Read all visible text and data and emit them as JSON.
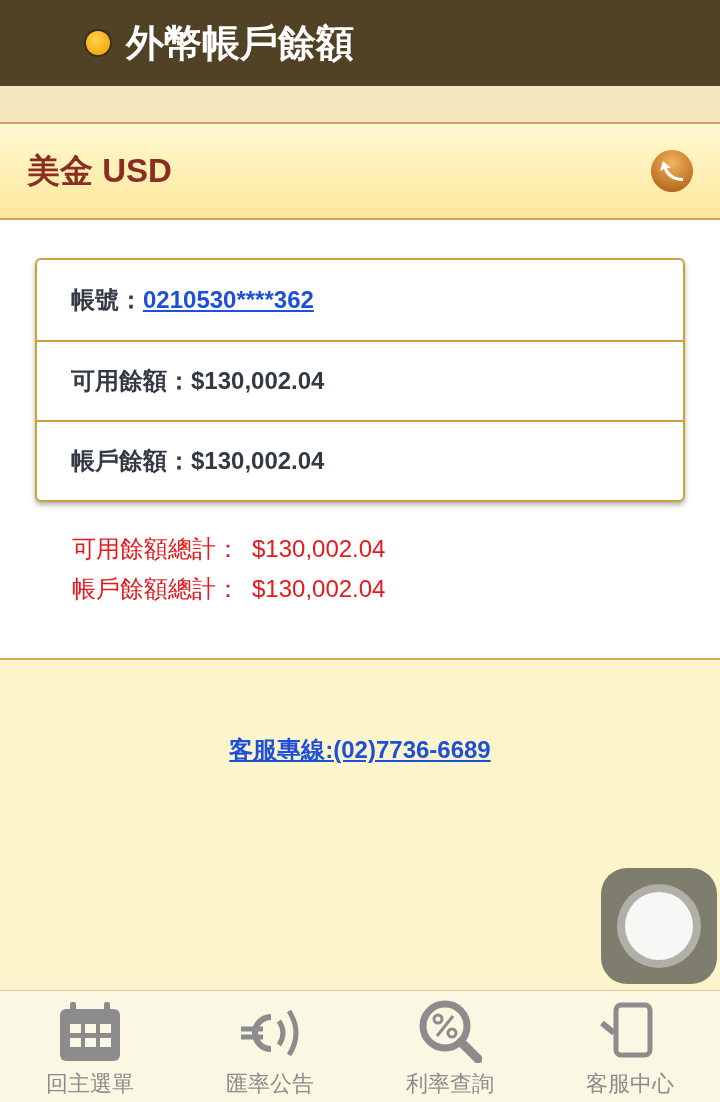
{
  "header": {
    "title": "外幣帳戶餘額"
  },
  "currency": {
    "title": "美金 USD"
  },
  "account": {
    "label": "帳號：",
    "number": "0210530****362"
  },
  "balances": [
    {
      "label": "可用餘額：",
      "value": "$130,002.04"
    },
    {
      "label": "帳戶餘額：",
      "value": "$130,002.04"
    }
  ],
  "totals": [
    {
      "label": "可用餘額總計：",
      "value": "$130,002.04"
    },
    {
      "label": "帳戶餘額總計：",
      "value": "$130,002.04"
    }
  ],
  "hotline": "客服專線:(02)7736-6689",
  "tab_bar": [
    {
      "kind": "calendar",
      "label": "回主選單"
    },
    {
      "kind": "euro",
      "label": "匯率公告"
    },
    {
      "kind": "percent",
      "label": "利率查詢"
    },
    {
      "kind": "phone",
      "label": "客服中心"
    }
  ]
}
